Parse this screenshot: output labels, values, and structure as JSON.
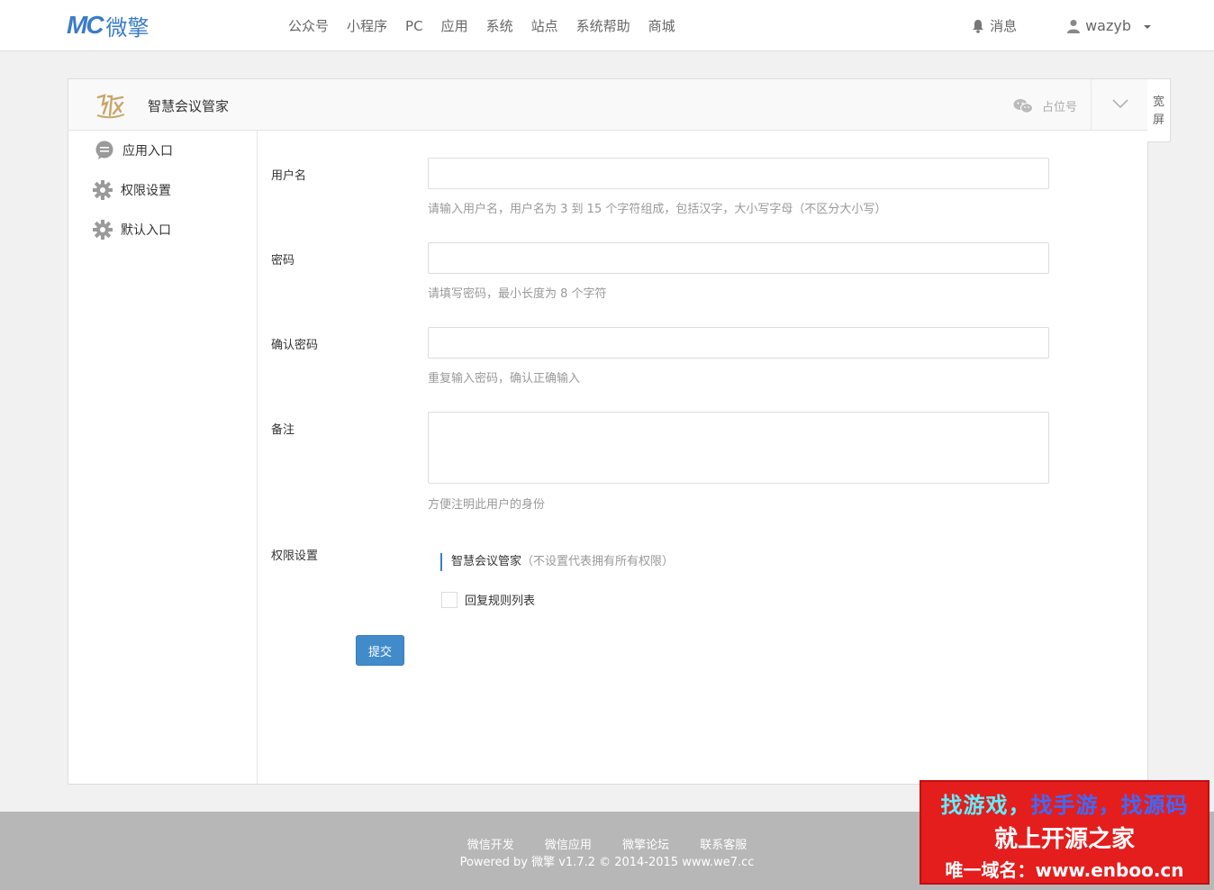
{
  "brand": {
    "mark": "MC",
    "name": "微擎",
    "color": "#3a7cc8"
  },
  "nav": {
    "items": [
      "公众号",
      "小程序",
      "PC",
      "应用",
      "系统",
      "站点",
      "系统帮助",
      "商城"
    ]
  },
  "header_right": {
    "messages": "消息",
    "username": "wazyb"
  },
  "panel": {
    "app_name": "智慧会议管家",
    "account_placeholder": "占位号",
    "wide_screen": [
      "宽",
      "屏"
    ]
  },
  "sidebar": {
    "items": [
      {
        "label": "应用入口",
        "icon": "chat-bubble-icon"
      },
      {
        "label": "权限设置",
        "icon": "gear-icon"
      },
      {
        "label": "默认入口",
        "icon": "gear-icon"
      }
    ]
  },
  "form": {
    "username": {
      "label": "用户名",
      "value": "",
      "help": "请输入用户名，用户名为 3 到 15 个字符组成，包括汉字，大小写字母（不区分大小写）"
    },
    "password": {
      "label": "密码",
      "value": "",
      "help": "请填写密码，最小长度为 8 个字符"
    },
    "confirm_password": {
      "label": "确认密码",
      "value": "",
      "help": "重复输入密码，确认正确输入"
    },
    "remark": {
      "label": "备注",
      "value": "",
      "help": "方便注明此用户的身份"
    },
    "permissions": {
      "label": "权限设置",
      "group_title": "智慧会议管家",
      "group_note": "（不设置代表拥有所有权限）",
      "options": [
        {
          "label": "回复规则列表",
          "checked": false
        }
      ]
    },
    "submit_label": "提交"
  },
  "footer": {
    "links": [
      "微信开发",
      "微信应用",
      "微擎论坛",
      "联系客服"
    ],
    "copyright": "Powered by 微擎 v1.7.2 © 2014-2015 www.we7.cc"
  },
  "watermark": {
    "line1_a": "找游戏，",
    "line1_b": "找手游，",
    "line1_c": "找源码",
    "line2": "就上开源之家",
    "line3": "唯一域名：www.enboo.cn"
  }
}
